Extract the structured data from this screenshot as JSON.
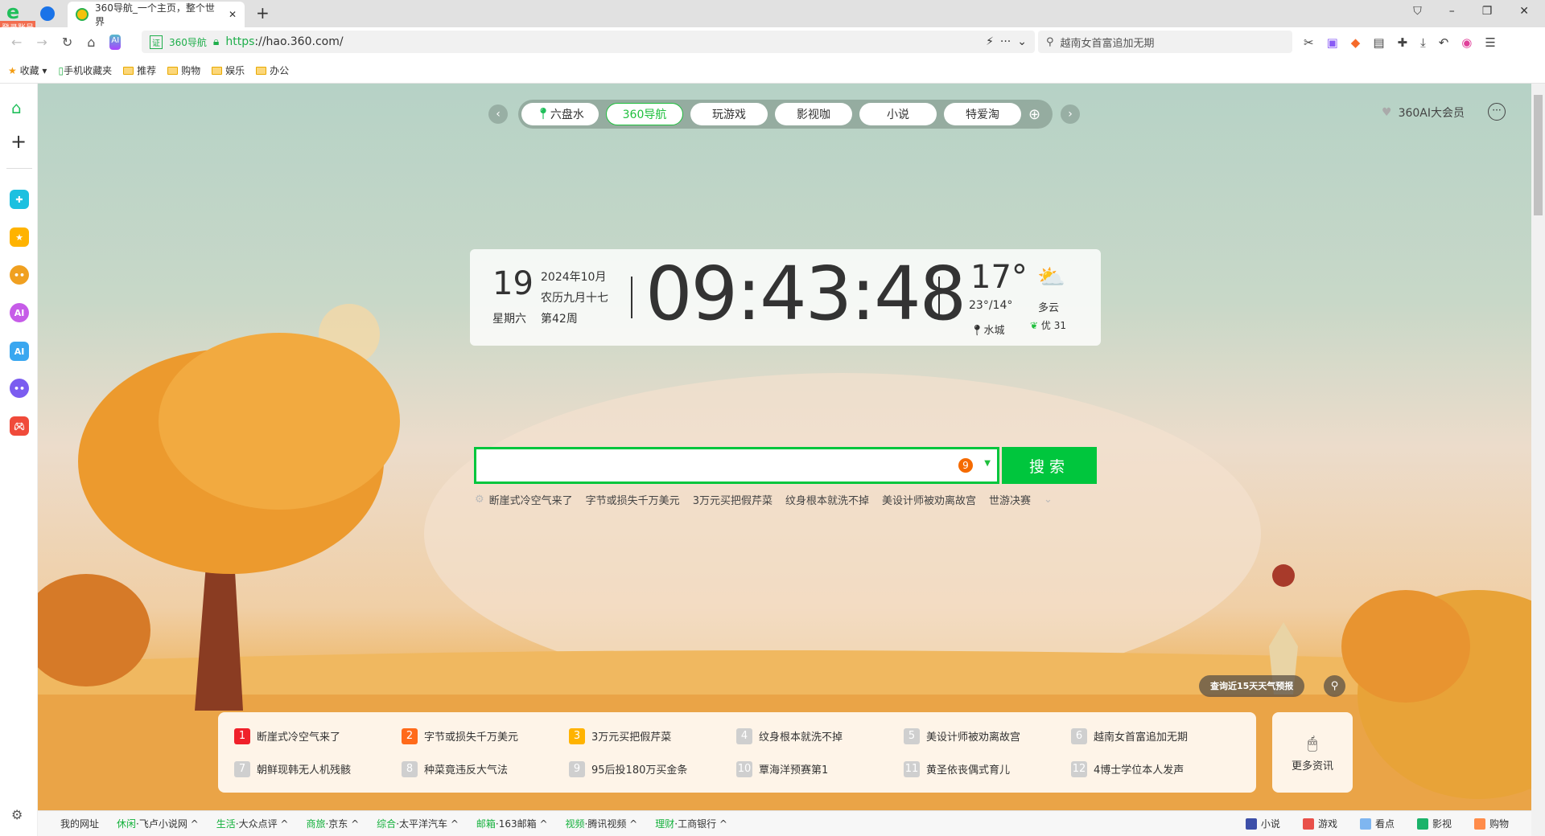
{
  "browser": {
    "login_badge": "登录账号",
    "tab_title": "360导航_一个主页，整个世界",
    "site_label": "360导航",
    "url_scheme": "https",
    "url_rest": "://hao.360.com/",
    "search_hint": "越南女首富追加无期"
  },
  "bookmarks": [
    "收藏",
    "手机收藏夹",
    "推荐",
    "购物",
    "娱乐",
    "办公"
  ],
  "nav": {
    "pills": [
      "六盘水",
      "360导航",
      "玩游戏",
      "影视咖",
      "小说",
      "特爱淘"
    ],
    "active": 1,
    "member": "360AI大会员"
  },
  "clock": {
    "day": "19",
    "weekday": "星期六",
    "month": "2024年10月",
    "lunar": "农历九月十七",
    "week": "第42周",
    "time": "09:43:48",
    "temp": "17°",
    "range": "23°/14°",
    "city": "水城",
    "condition": "多云",
    "aqi": "优 31"
  },
  "search": {
    "value": "",
    "badge": "9",
    "button": "搜索",
    "hot": [
      "断崖式冷空气来了",
      "字节或损失千万美元",
      "3万元买把假芹菜",
      "纹身根本就洗不掉",
      "美设计师被劝离故宫",
      "世游决赛"
    ]
  },
  "weather_pill": "查询近15天天气预报",
  "news": {
    "items": [
      {
        "n": "1",
        "t": "断崖式冷空气来了"
      },
      {
        "n": "2",
        "t": "字节或损失千万美元"
      },
      {
        "n": "3",
        "t": "3万元买把假芹菜"
      },
      {
        "n": "4",
        "t": "纹身根本就洗不掉"
      },
      {
        "n": "5",
        "t": "美设计师被劝离故宫"
      },
      {
        "n": "6",
        "t": "越南女首富追加无期"
      },
      {
        "n": "7",
        "t": "朝鲜现韩无人机残骸"
      },
      {
        "n": "8",
        "t": "种菜竟违反大气法"
      },
      {
        "n": "9",
        "t": "95后投180万买金条"
      },
      {
        "n": "10",
        "t": "覃海洋预赛第1"
      },
      {
        "n": "11",
        "t": "黄圣依丧偶式育儿"
      },
      {
        "n": "12",
        "t": "4博士学位本人发声"
      }
    ],
    "rank_colors": [
      "#f0202a",
      "#ff6a1a",
      "#ffb300"
    ],
    "more": "更多资讯"
  },
  "footer": {
    "mine": "我的网址",
    "groups": [
      {
        "k": "休闲",
        "v": "·飞卢小说网"
      },
      {
        "k": "生活",
        "v": "·大众点评"
      },
      {
        "k": "商旅",
        "v": "·京东"
      },
      {
        "k": "综合",
        "v": "·太平洋汽车"
      },
      {
        "k": "邮箱",
        "v": "·163邮箱"
      },
      {
        "k": "视频",
        "v": "·腾讯视频"
      },
      {
        "k": "理财",
        "v": "·工商银行"
      }
    ],
    "right": [
      {
        "t": "小说",
        "c": "#3d4fa8"
      },
      {
        "t": "游戏",
        "c": "#e9504a"
      },
      {
        "t": "看点",
        "c": "#7fb6f0"
      },
      {
        "t": "影视",
        "c": "#1bb36a"
      },
      {
        "t": "购物",
        "c": "#ff8c4a"
      }
    ]
  },
  "colors": {
    "accent": "#00c63d"
  }
}
